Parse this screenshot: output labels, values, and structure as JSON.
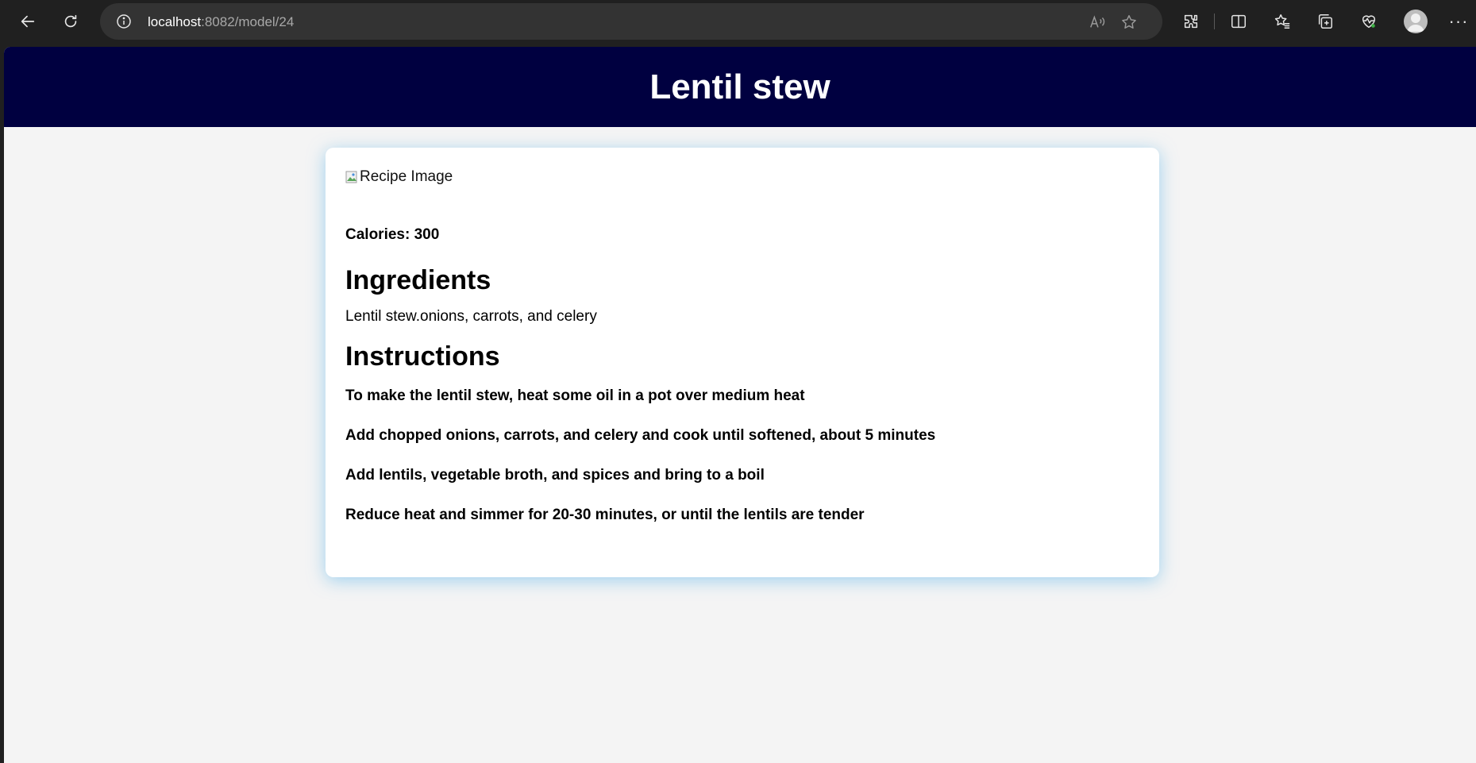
{
  "browser": {
    "url_host": "localhost",
    "url_path": ":8082/model/24"
  },
  "page": {
    "title": "Lentil stew",
    "image_alt": "Recipe Image",
    "calories_label": "Calories: 300",
    "ingredients_heading": "Ingredients",
    "ingredients_text": "Lentil stew.onions, carrots, and celery",
    "instructions_heading": "Instructions",
    "steps": [
      "To make the lentil stew, heat some oil in a pot over medium heat",
      "Add chopped onions, carrots, and celery and cook until softened, about 5 minutes",
      "Add lentils, vegetable broth, and spices and bring to a boil",
      "Reduce heat and simmer for 20-30 minutes, or until the lentils are tender"
    ]
  },
  "colors": {
    "header_bg": "#000040",
    "page_bg": "#f4f4f4",
    "card_bg": "#ffffff",
    "card_glow": "#5ab4eb"
  }
}
